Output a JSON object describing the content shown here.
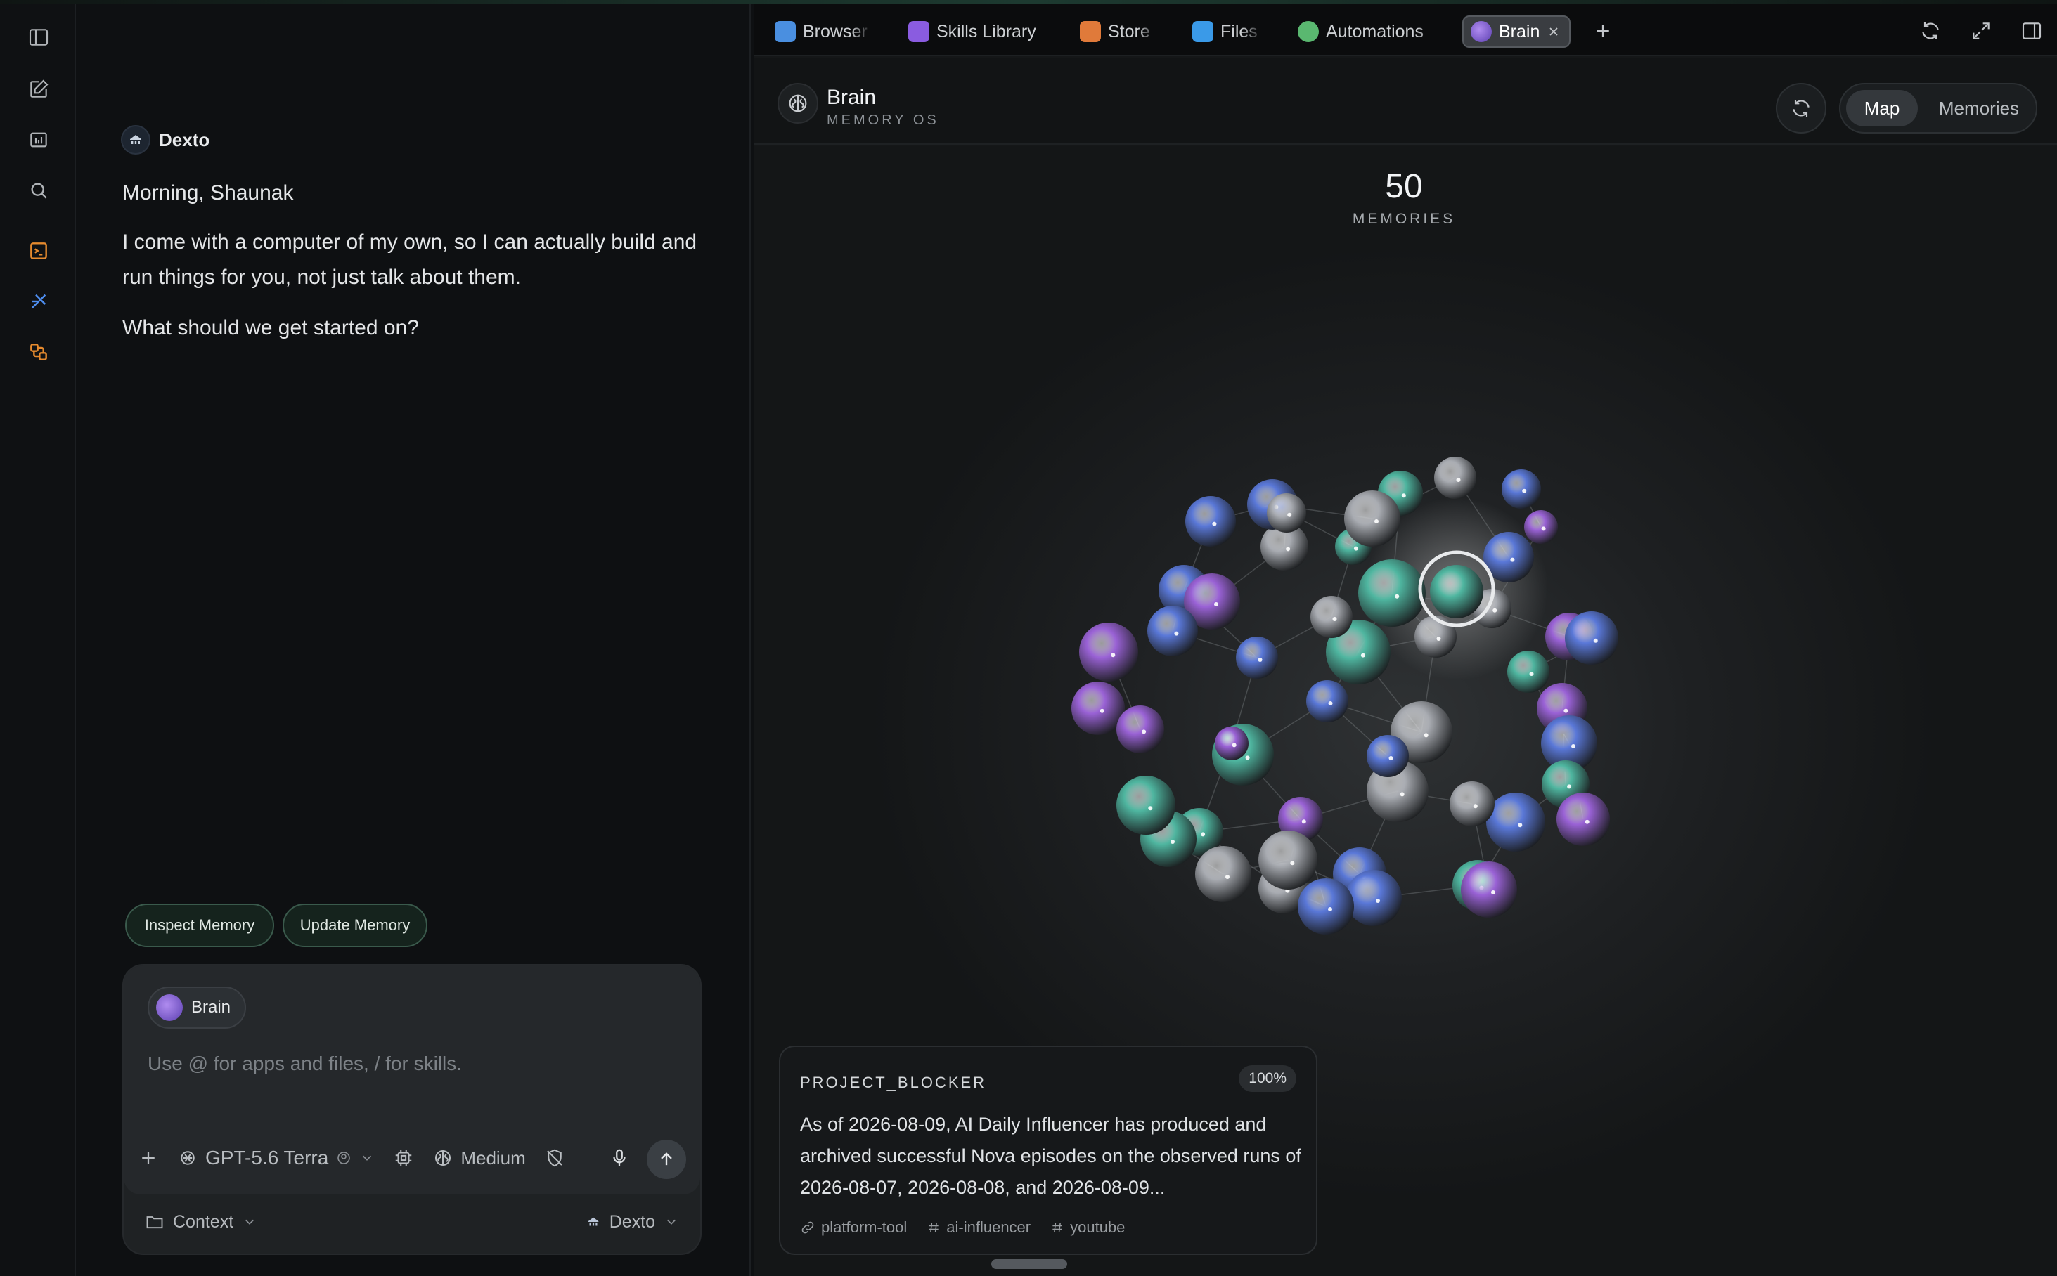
{
  "rail": {
    "items": [
      "sidebar-toggle",
      "new-chat",
      "library",
      "search",
      "terminal",
      "skills",
      "automations"
    ]
  },
  "chat": {
    "agent_name": "Dexto",
    "greeting": "Morning, Shaunak",
    "message_1": "I come with a computer of my own, so I can actually build and run things for you, not just talk about them.",
    "message_2": "What should we get started on?",
    "suggestions": [
      "Inspect Memory",
      "Update Memory"
    ],
    "composer": {
      "chip_label": "Brain",
      "placeholder": "Use @ for apps and files, / for skills.",
      "model": "GPT-5.6 Terra",
      "effort": "Medium",
      "context_label": "Context",
      "agent_label": "Dexto"
    }
  },
  "tabs": [
    {
      "label": "Browser",
      "color": "#4a8fe0"
    },
    {
      "label": "Skills Library",
      "color": "#8a5ce0"
    },
    {
      "label": "Store",
      "color": "#e07a3a"
    },
    {
      "label": "Files",
      "color": "#3a9ae8"
    },
    {
      "label": "Automations",
      "color": "#5ab870"
    },
    {
      "label": "Brain",
      "color": "#7a58d0"
    }
  ],
  "brain": {
    "title": "Brain",
    "subtitle": "MEMORY OS",
    "view_map": "Map",
    "view_memories": "Memories",
    "memory_count": "50",
    "memory_count_label": "MEMORIES"
  },
  "memory_card": {
    "category": "PROJECT_BLOCKER",
    "confidence": "100%",
    "text": "As of 2026-08-09, AI Daily Influencer has produced and archived successful Nova episodes on the observed runs of 2026-08-07, 2026-08-08, and 2026-08-09...",
    "tags": [
      "platform-tool",
      "ai-influencer",
      "youtube"
    ]
  },
  "colors": {
    "accent": "#3a5a4c",
    "teal": "#4fb6a0",
    "blue": "#5a78d8",
    "purple": "#9a62d6",
    "gray": "#a9acb2"
  }
}
